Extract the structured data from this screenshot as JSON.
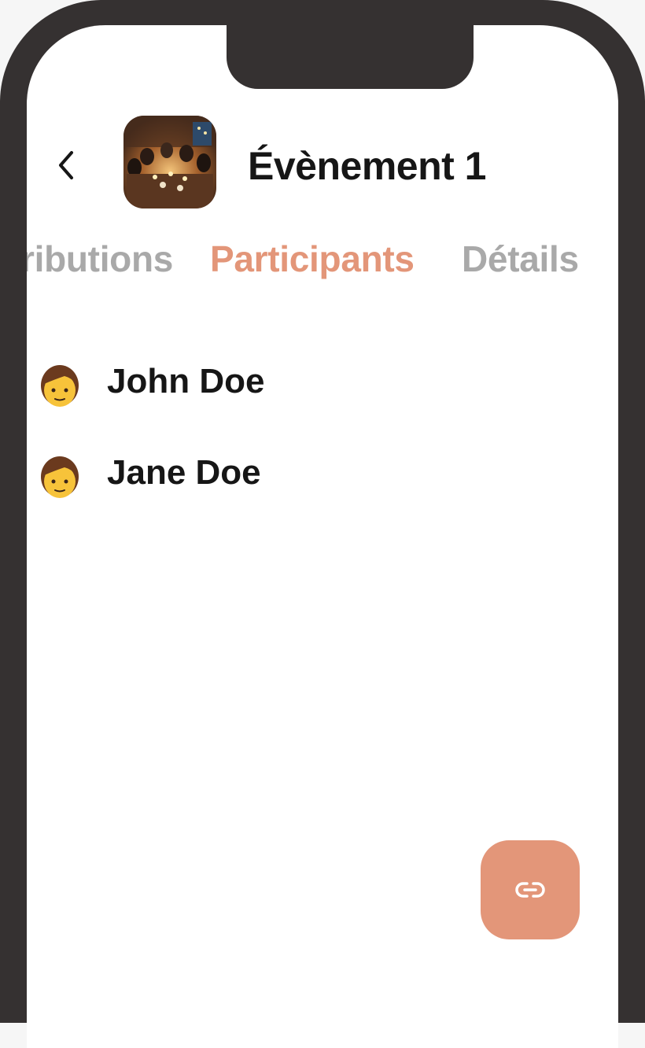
{
  "header": {
    "back_icon": "chevron-left-icon",
    "event_title": "Évènement 1",
    "event_image": "dinner-party-photo"
  },
  "tabs": [
    {
      "label": "ributions",
      "active": false
    },
    {
      "label": "Participants",
      "active": true
    },
    {
      "label": "Détails",
      "active": false
    }
  ],
  "participants": [
    {
      "name": "John Doe",
      "avatar": "person-emoji"
    },
    {
      "name": "Jane Doe",
      "avatar": "person-emoji"
    }
  ],
  "fab": {
    "icon": "link-icon"
  },
  "colors": {
    "accent": "#e39679",
    "tab_inactive": "#a9a9a9",
    "frame": "#353131",
    "text": "#161616"
  }
}
